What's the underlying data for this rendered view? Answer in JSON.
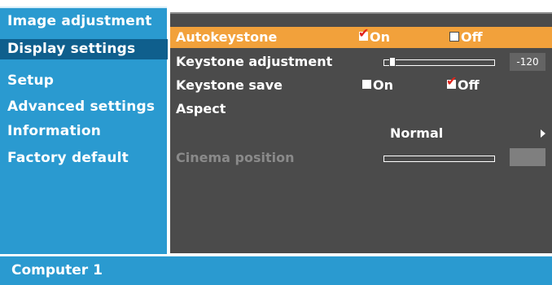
{
  "sidebar": {
    "items": [
      {
        "label": "Image adjustment"
      },
      {
        "label": "Display settings"
      },
      {
        "label": "Setup"
      },
      {
        "label": "Advanced settings"
      },
      {
        "label": "Information"
      },
      {
        "label": "Factory default"
      }
    ],
    "selected_index": 1
  },
  "panel": {
    "auto_keystone": {
      "label": "Autokeystone",
      "on_label": "On",
      "off_label": "Off",
      "selected": "On"
    },
    "keystone_adjustment": {
      "label": "Keystone adjustment",
      "value": "-120"
    },
    "keystone_save": {
      "label": "Keystone save",
      "on_label": "On",
      "off_label": "Off",
      "selected": "Off"
    },
    "aspect": {
      "label": "Aspect",
      "value": "Normal"
    },
    "cinema_position": {
      "label": "Cinema position",
      "enabled": false
    }
  },
  "status_bar": {
    "source": "Computer 1"
  },
  "colors": {
    "sidebar_bg": "#2a9ad0",
    "sidebar_selected": "#0f5f8d",
    "panel_bg": "#4b4b4b",
    "highlight": "#f2a13b",
    "check_mark": "#e2231a"
  }
}
